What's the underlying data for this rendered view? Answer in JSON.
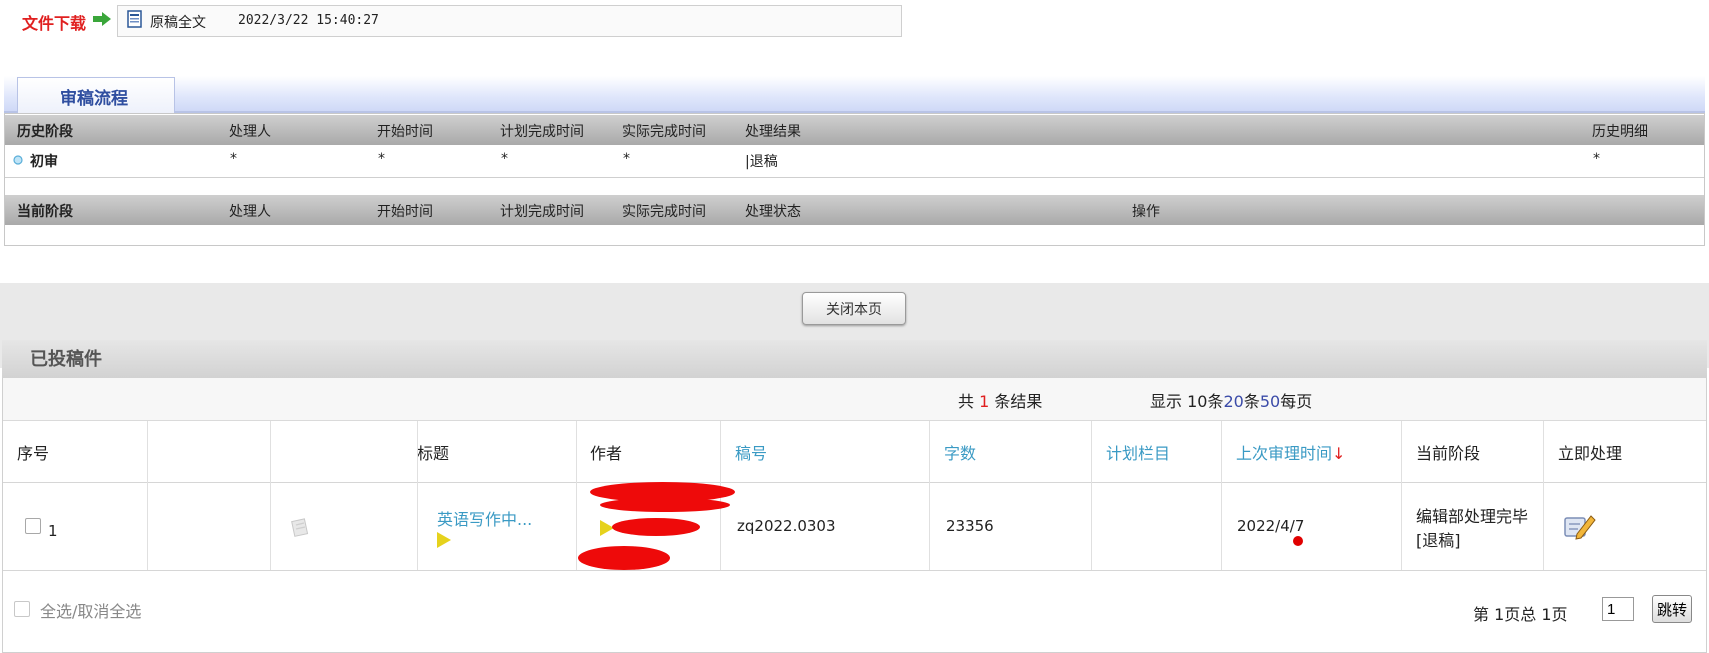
{
  "download": {
    "label": "文件下载",
    "file_name": "原稿全文",
    "file_time": "2022/3/22 15:40:27"
  },
  "review_flow": {
    "tab_title": "审稿流程",
    "history_headers": [
      "历史阶段",
      "处理人",
      "开始时间",
      "计划完成时间",
      "实际完成时间",
      "处理结果",
      "历史明细"
    ],
    "history_row": {
      "stage": "初审",
      "handler": "*",
      "start": "*",
      "planned": "*",
      "actual": "*",
      "result": "|退稿",
      "detail": "*"
    },
    "current_headers": [
      "当前阶段",
      "处理人",
      "开始时间",
      "计划完成时间",
      "实际完成时间",
      "处理状态",
      "操作"
    ]
  },
  "close_button": "关闭本页",
  "submitted": {
    "title": "已投稿件",
    "summary_pre": "共",
    "total": "1",
    "summary_post": "条结果",
    "page_size_pre": "显示 10条",
    "page_size_20": "20",
    "page_size_mid": "条",
    "page_size_50": "50",
    "page_size_post": "每页",
    "columns": [
      "序号",
      "",
      "",
      "标题",
      "作者",
      "稿号",
      "字数",
      "计划栏目",
      "上次审理时间",
      "当前阶段",
      "立即处理"
    ],
    "sort_arrow": "↓",
    "rows": [
      {
        "index": "1",
        "title": "英语写作中...",
        "author": "",
        "manuscript_no": "zq2022.0303",
        "word_count": "23356",
        "column": "",
        "last_review": "2022/4/7",
        "stage": "编辑部处理完毕[退稿]"
      }
    ],
    "select_all": "全选/取消全选",
    "pagination": "第 1页总 1页",
    "page_input": "1",
    "jump_button": "跳转"
  }
}
